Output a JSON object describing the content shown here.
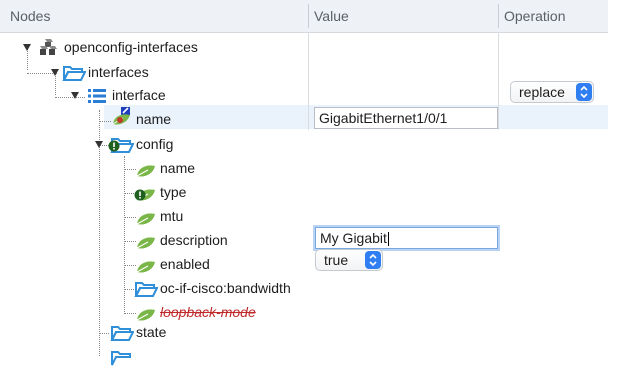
{
  "header": {
    "nodes_label": "Nodes",
    "value_label": "Value",
    "operation_label": "Operation"
  },
  "tree": {
    "root": "openconfig-interfaces",
    "interfaces": "interfaces",
    "interface": "interface",
    "key_name": "name",
    "config": "config",
    "config_children": {
      "name": "name",
      "type": "type",
      "mtu": "mtu",
      "description": "description",
      "enabled": "enabled",
      "bandwidth": "oc-if-cisco:bandwidth",
      "loopback": "loopback-mode"
    },
    "state": "state"
  },
  "values": {
    "name": "GigabitEthernet1/0/1",
    "description": "My Gigabit",
    "enabled": "true"
  },
  "operation": {
    "interface_op": "replace"
  },
  "colors": {
    "leaf_green": "#7ab648",
    "folder_blue": "#2f8fd8",
    "list_blue": "#2a7fd4",
    "highlight_row": "#eaf2fb",
    "alert_dark_green": "#1f5f1f",
    "strike_red": "#c02a2a"
  },
  "icons": {
    "module": "cubes-icon",
    "container": "folder-open-icon",
    "list": "list-icon",
    "leaf": "leaf-icon",
    "key_leaf": "key-leaf-icon",
    "warning": "exclamation-badge-icon"
  }
}
